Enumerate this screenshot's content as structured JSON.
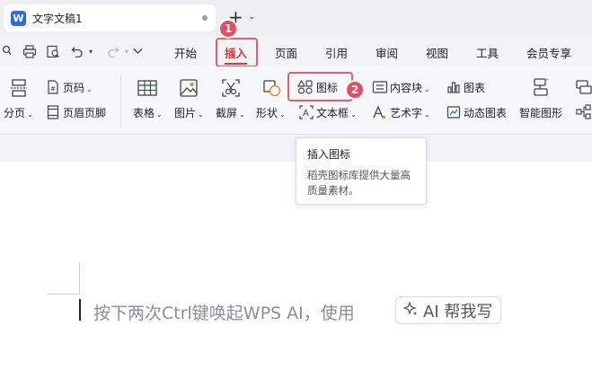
{
  "tabbar": {
    "logo_letter": "W",
    "doc_title": "文字文稿1"
  },
  "menu": {
    "items": [
      "开始",
      "插入",
      "页面",
      "引用",
      "审阅",
      "视图",
      "工具",
      "会员专享"
    ],
    "active": "插入"
  },
  "ribbon": {
    "page_number": "页码",
    "break": "分页",
    "header_footer": "页眉页脚",
    "table": "表格",
    "picture": "图片",
    "screenshot": "截屏",
    "shape": "形状",
    "icon": "图标",
    "textbox": "文本框",
    "content_block": "内容块",
    "wordart": "艺术字",
    "chart": "图表",
    "dynamic_chart": "动态图表",
    "smart_shape": "智能图形"
  },
  "annotations": {
    "badge1": "1",
    "badge2": "2"
  },
  "tooltip": {
    "title": "插入图标",
    "body": "稻壳图标库提供大量高质量素材。"
  },
  "document": {
    "hint": "按下两次Ctrl键唤起WPS AI，使用",
    "ai_button": "AI 帮我写"
  },
  "colors": {
    "accent": "#d9363e",
    "annotation_red": "#e84d5f",
    "brand_blue": "#2b6be6"
  }
}
